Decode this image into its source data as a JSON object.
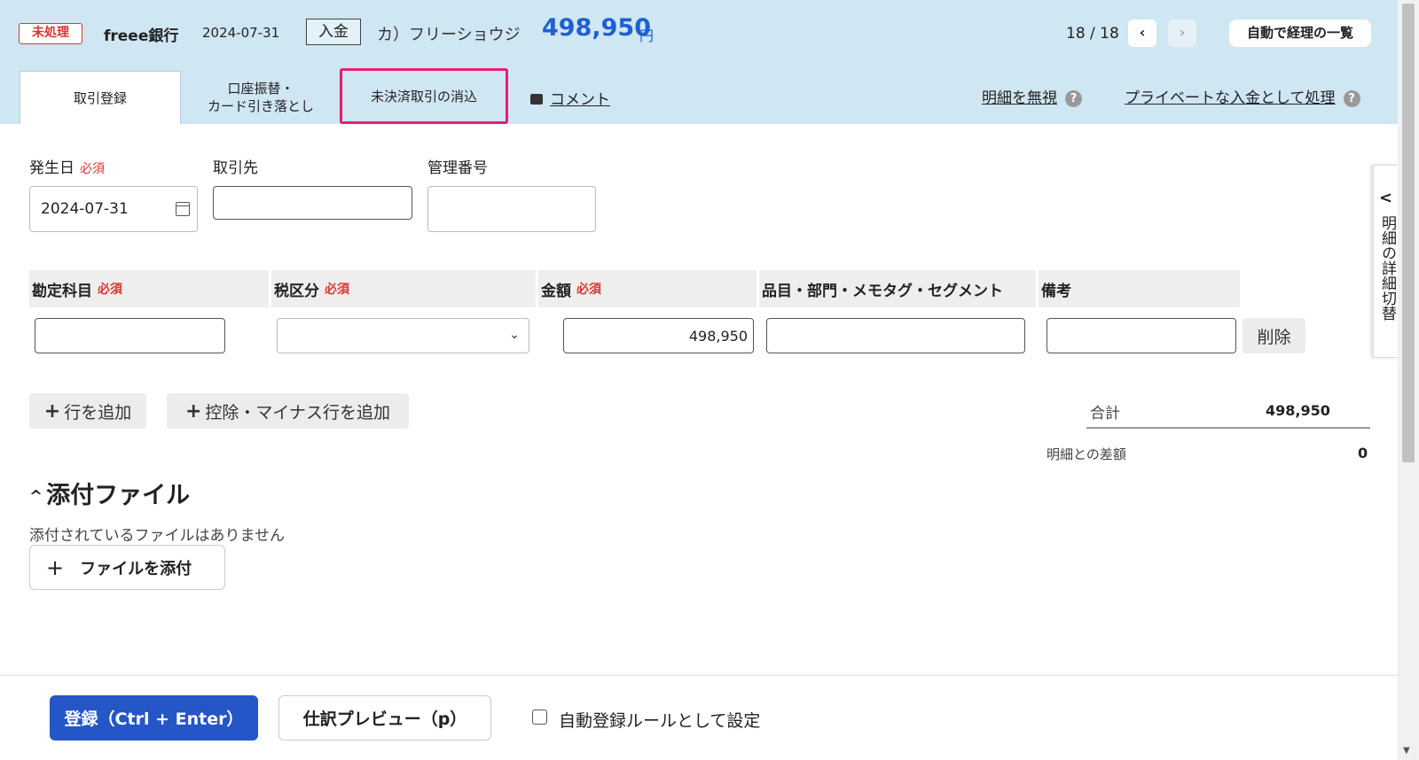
{
  "header": {
    "status": "未処理",
    "bank": "freee銀行",
    "date": "2024-07-31",
    "type": "入金",
    "payee": "カ）フリーショウジ",
    "amount": "498,950",
    "currency": "円",
    "pager": "18 / 18",
    "prev": "‹",
    "next": "›",
    "list_button": "自動で経理の一覧"
  },
  "tabs": {
    "register": "取引登録",
    "transfer_line1": "口座振替・",
    "transfer_line2": "カード引き落とし",
    "clear": "未決済取引の消込",
    "comment": "コメント",
    "ignore": "明細を無視",
    "private": "プライベートな入金として処理",
    "help": "?"
  },
  "form": {
    "date_label": "発生日",
    "required": "必須",
    "date_value": "2024-07-31",
    "partner_label": "取引先",
    "partner_value": "",
    "mgmt_label": "管理番号",
    "mgmt_value": ""
  },
  "table": {
    "headers": {
      "account": "勘定科目",
      "tax": "税区分",
      "amount": "金額",
      "items": "品目・部門・メモタグ・セグメント",
      "note": "備考"
    },
    "row": {
      "account": "",
      "tax": "",
      "amount": "498,950",
      "items": "",
      "note": "",
      "delete": "削除"
    },
    "add_row": "行を追加",
    "add_minus_row": "控除・マイナス行を追加",
    "total_label": "合計",
    "total_value": "498,950",
    "diff_label": "明細との差額",
    "diff_value": "0"
  },
  "attachments": {
    "title": "添付ファイル",
    "empty": "添付されているファイルはありません",
    "add": "ファイルを添付"
  },
  "side_panel": {
    "label": "明細の詳細切替"
  },
  "footer": {
    "submit": "登録（Ctrl + Enter）",
    "preview": "仕訳プレビュー（p）",
    "auto_rule": "自動登録ルールとして設定"
  },
  "colors": {
    "accent": "#2456c8",
    "highlight": "#e5206e",
    "header_bg": "#cfe6f3",
    "required": "#d33333"
  }
}
